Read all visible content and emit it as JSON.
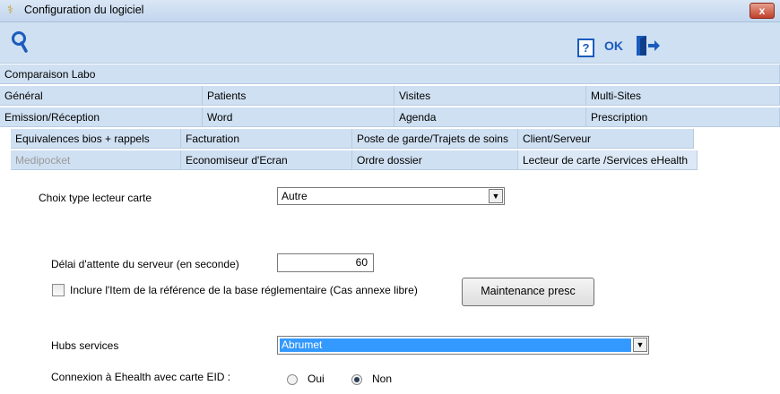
{
  "window": {
    "title": "Configuration du logiciel",
    "close_label": "x"
  },
  "toolbar": {
    "help_label": "?",
    "ok_label": "OK"
  },
  "tabs": {
    "row1": [
      "Comparaison Labo"
    ],
    "row2": [
      "Général",
      "Patients",
      "Visites",
      "Multi-Sites"
    ],
    "row3": [
      "Emission/Réception",
      "Word",
      "Agenda",
      "Prescription"
    ],
    "row4": [
      "Equivalences bios + rappels",
      "Facturation",
      "Poste de garde/Trajets de soins",
      "Client/Serveur"
    ],
    "row5": [
      "Medipocket",
      "Economiseur d'Ecran",
      "Ordre dossier",
      "Lecteur de carte /Services eHealth"
    ]
  },
  "form": {
    "card_reader_label": "Choix type lecteur carte",
    "card_reader_value": "Autre",
    "timeout_label": "Délai d'attente du serveur (en seconde)",
    "timeout_value": "60",
    "include_item_label": "Inclure l'Item de la référence de la base réglementaire (Cas annexe libre)",
    "maintenance_button": "Maintenance presc",
    "hubs_label": "Hubs services",
    "hubs_value": "Abrumet",
    "eid_label": "Connexion à Ehealth avec carte EID :",
    "eid_options": [
      "Oui",
      "Non"
    ],
    "eid_selected": "Non"
  }
}
